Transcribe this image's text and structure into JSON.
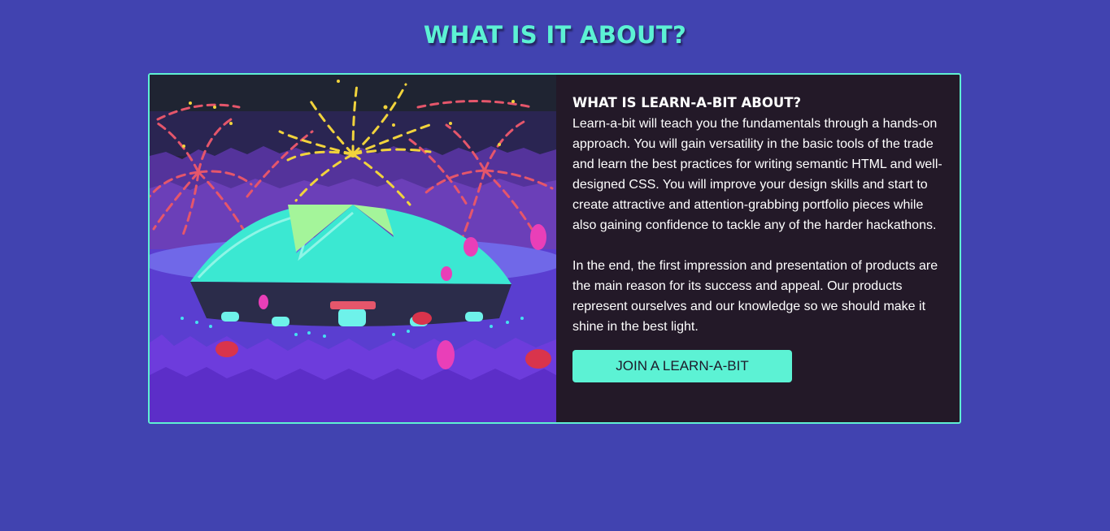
{
  "section": {
    "title": "WHAT IS IT ABOUT?"
  },
  "card": {
    "heading": "WHAT IS LEARN-A-BIT ABOUT?",
    "paragraphs": [
      "Learn-a-bit will teach you the fundamentals through a hands-on approach. You will gain versatility in the basic tools of the trade and learn the best practices for writing semantic HTML and well-designed CSS. You will improve your design skills and start to create attractive and attention-grabbing portfolio pieces while also gaining confidence to tackle any of the harder hackathons.",
      "In the end, the first impression and presentation of products are the main reason for its success and appeal. Our products represent ourselves and our knowledge so we should make it shine in the best light."
    ],
    "button_label": "JOIN A LEARN-A-BIT",
    "illustration": {
      "icon": "fireworks-dome-arena-illustration"
    }
  },
  "colors": {
    "page_background": "#4143b0",
    "accent": "#5cf2d4",
    "card_background": "#231928",
    "text": "#ffffff"
  }
}
